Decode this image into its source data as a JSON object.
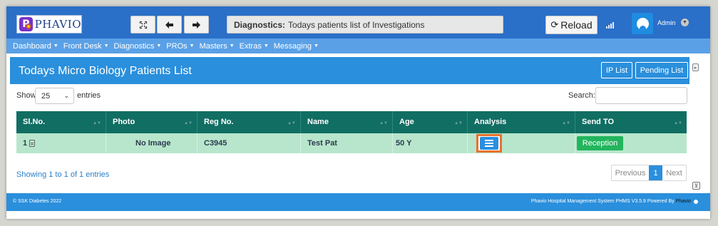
{
  "app": {
    "logo_text": "PHAVIO",
    "logo_letter": "P"
  },
  "toolbar": {
    "fullscreen_icon": "expand-icon",
    "back_icon": "arrow-left-icon",
    "forward_icon": "arrow-right-icon",
    "diag_label": "Diagnostics:",
    "diag_text": "Todays patients list of Investigations",
    "reload_label": "Reload",
    "user_name": "Admin"
  },
  "nav": {
    "items": [
      {
        "label": "Dashboard"
      },
      {
        "label": "Front Desk"
      },
      {
        "label": "Diagnostics"
      },
      {
        "label": "PROs"
      },
      {
        "label": "Masters"
      },
      {
        "label": "Extras"
      },
      {
        "label": "Messaging"
      }
    ]
  },
  "panel": {
    "title": "Todays Micro Biology Patients List",
    "ip_list_label": "IP List",
    "pending_list_label": "Pending List"
  },
  "table_controls": {
    "show_label": "Show",
    "entries_value": "25",
    "entries_label": "entries",
    "search_label": "Search:",
    "search_value": ""
  },
  "table": {
    "headers": [
      "Sl.No.",
      "Photo",
      "Reg No.",
      "Name",
      "Age",
      "Analysis",
      "Send TO"
    ],
    "rows": [
      {
        "sl": "1",
        "photo": "No Image",
        "reg": "C3945",
        "name": "Test Pat",
        "age": "50 Y",
        "send_to": "Reception"
      }
    ]
  },
  "pagination": {
    "showing": "Showing 1 to 1 of 1 entries",
    "previous": "Previous",
    "current": "1",
    "next": "Next"
  },
  "footer": {
    "left": "© SSK Diabetes 2022",
    "right": "Phavio Hospital Management System PHMS V3.5.9 Powered By",
    "powered_link": "Phavio"
  },
  "colors": {
    "topbar": "#2a6fc8",
    "navbar": "#5aa0e6",
    "panel_header": "#2a8fdc",
    "table_header": "#116e63",
    "row_bg": "#b8e6cc",
    "reception_btn": "#22b55d",
    "highlight_border": "#e8722b"
  }
}
